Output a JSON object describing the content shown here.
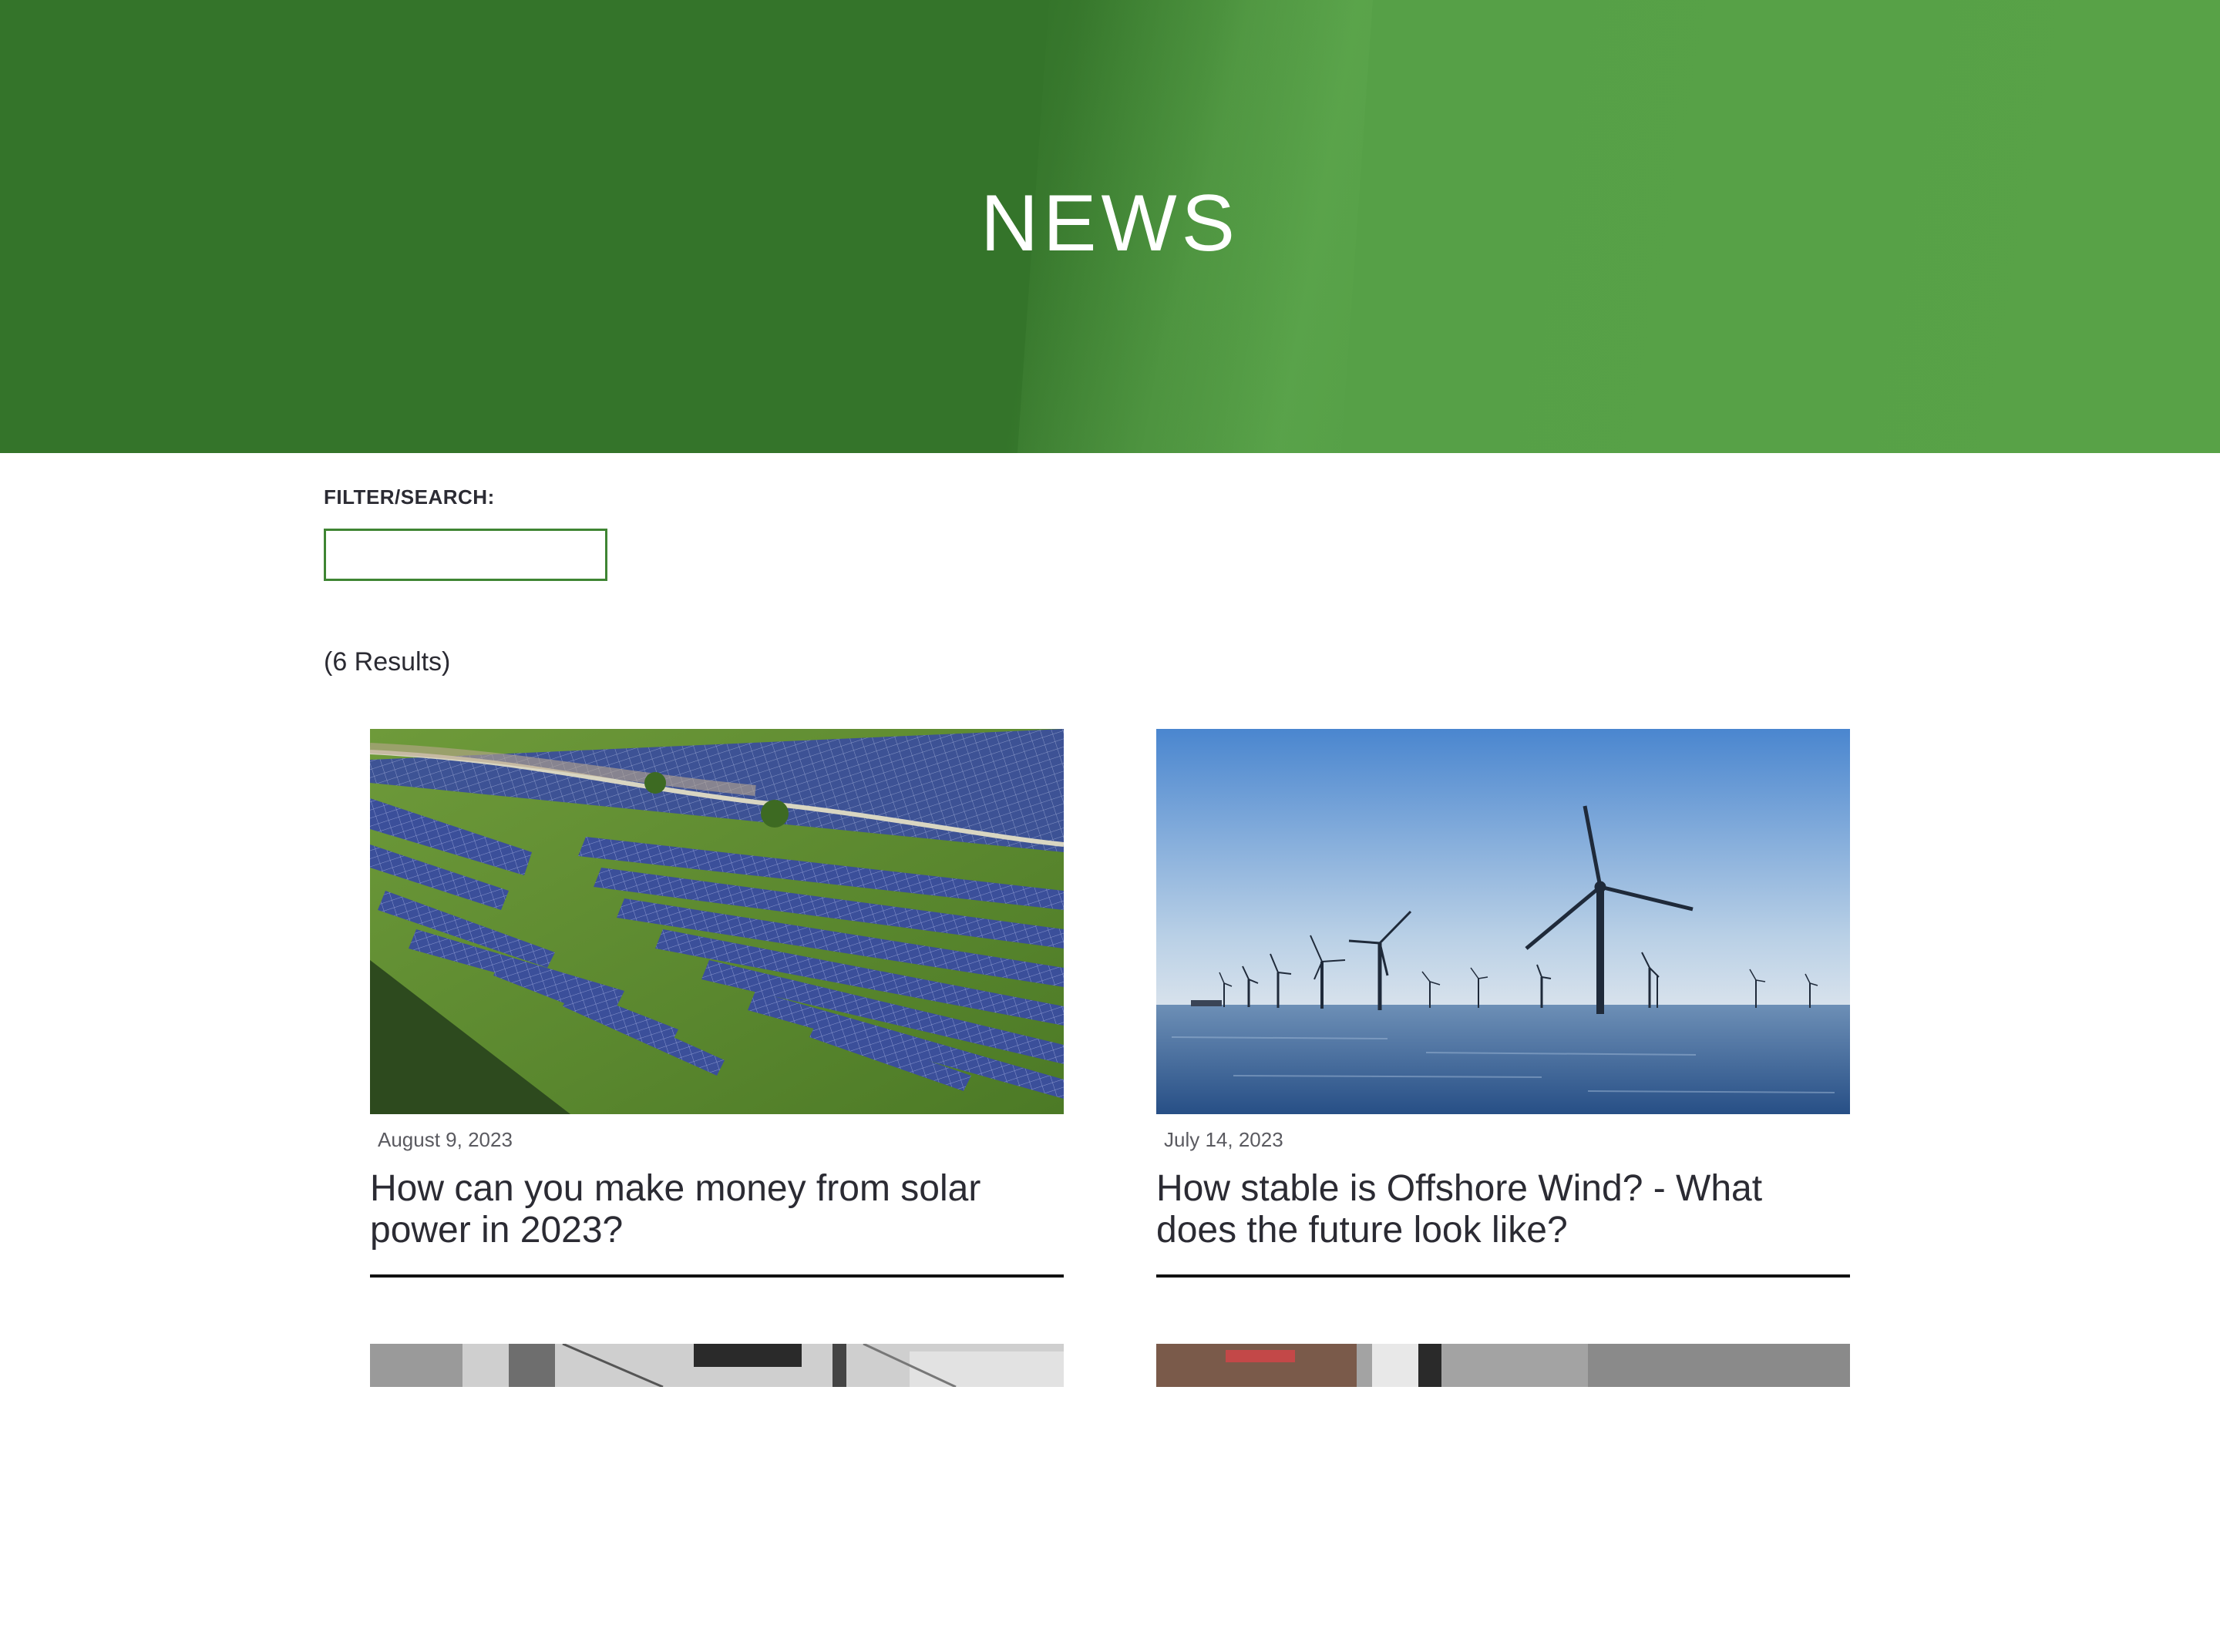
{
  "hero": {
    "title": "NEWS"
  },
  "filter": {
    "label": "FILTER/SEARCH:",
    "value": "",
    "placeholder": ""
  },
  "results": {
    "count_text": "(6 Results)"
  },
  "articles": [
    {
      "date": "August 9, 2023",
      "title": "How can you make money from solar power in 2023?",
      "image": "solar-farm-aerial-photo"
    },
    {
      "date": "July 14, 2023",
      "title": "How stable is Offshore Wind? - What does the future look like?",
      "image": "offshore-wind-turbines-photo"
    },
    {
      "date": "",
      "title": "",
      "image": "electrical-equipment-photo"
    },
    {
      "date": "",
      "title": "",
      "image": "control-panel-photo"
    }
  ],
  "colors": {
    "hero_dark": "#34742a",
    "hero_light": "#58a247",
    "accent": "#3f8533",
    "text": "#2b2b33"
  }
}
